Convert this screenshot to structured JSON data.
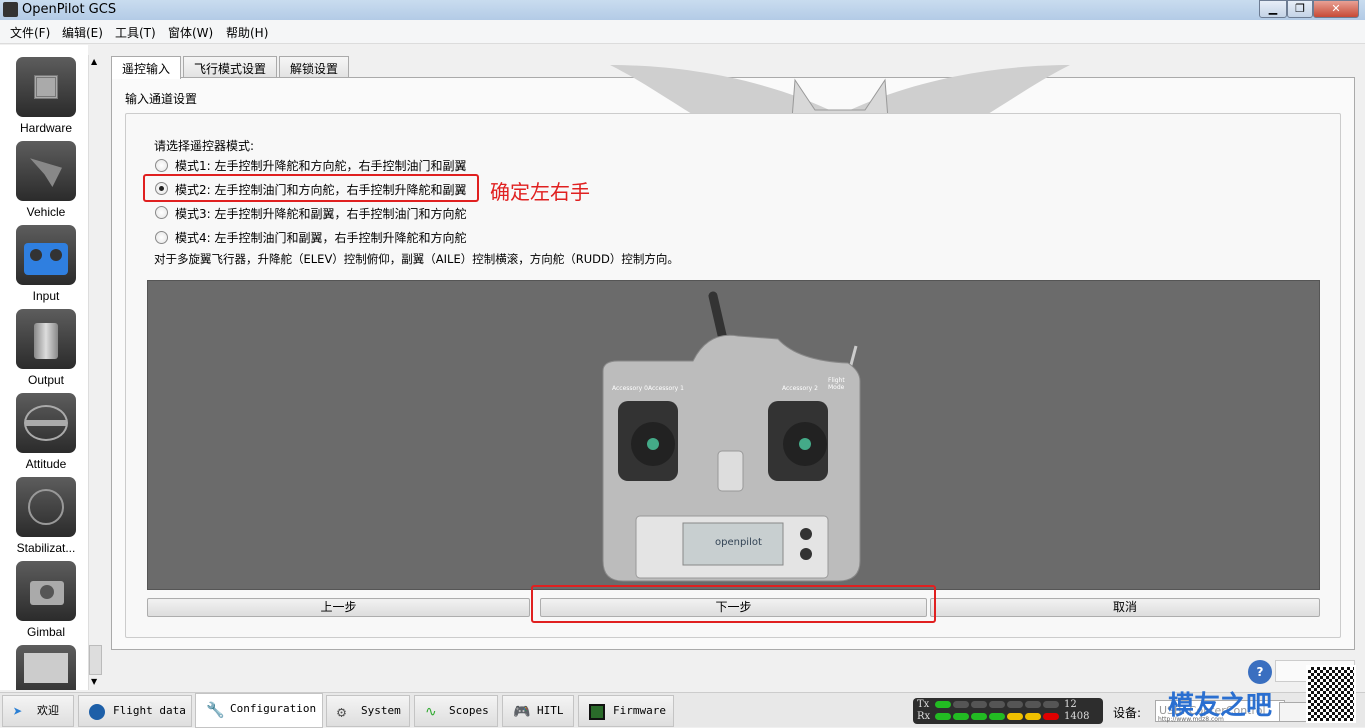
{
  "window": {
    "title": "OpenPilot GCS",
    "controls": [
      "minimize",
      "maximize",
      "close"
    ]
  },
  "menu": [
    "文件(F)",
    "编辑(E)",
    "工具(T)",
    "窗体(W)",
    "帮助(H)"
  ],
  "sidebar": {
    "items": [
      {
        "label": "Hardware",
        "icon": "chip-icon"
      },
      {
        "label": "Vehicle",
        "icon": "aircraft-icon"
      },
      {
        "label": "Input",
        "icon": "transmitter-icon",
        "active": true
      },
      {
        "label": "Output",
        "icon": "motor-icon"
      },
      {
        "label": "Attitude",
        "icon": "level-icon"
      },
      {
        "label": "Stabilizat...",
        "icon": "gyro-icon"
      },
      {
        "label": "Gimbal",
        "icon": "camera-icon"
      },
      {
        "label": "",
        "icon": "gauge-icon"
      }
    ]
  },
  "tabs": [
    {
      "label": "遥控输入",
      "active": true
    },
    {
      "label": "飞行模式设置"
    },
    {
      "label": "解锁设置"
    }
  ],
  "group": {
    "title": "输入通道设置",
    "prompt": "请选择遥控器模式:",
    "modes": [
      {
        "label": "模式1: 左手控制升降舵和方向舵，右手控制油门和副翼",
        "selected": false
      },
      {
        "label": "模式2: 左手控制油门和方向舵，右手控制升降舵和副翼",
        "selected": true
      },
      {
        "label": "模式3: 左手控制升降舵和副翼，右手控制油门和方向舵",
        "selected": false
      },
      {
        "label": "模式4: 左手控制油门和副翼，右手控制升降舵和方向舵",
        "selected": false
      }
    ],
    "note": "对于多旋翼飞行器，升降舵（ELEV）控制俯仰，副翼（AILE）控制横滚，方向舵（RUDD）控制方向。",
    "annotation": "确定左右手",
    "transmitter": {
      "acc0": "Accessory 0",
      "acc1": "Accessory 1",
      "acc2": "Accessory 2",
      "flight_mode": "Flight Mode",
      "brand": "openpilot"
    }
  },
  "buttons": {
    "back": "上一步",
    "next": "下一步",
    "cancel": "取消"
  },
  "bottom_tabs": [
    {
      "label": "欢迎",
      "icon": "welcome-icon"
    },
    {
      "label": "Flight data",
      "icon": "flight-data-icon"
    },
    {
      "label": "Configuration",
      "icon": "wrench-icon",
      "active": true
    },
    {
      "label": "System",
      "icon": "gear-icon"
    },
    {
      "label": "Scopes",
      "icon": "scope-icon"
    },
    {
      "label": "HITL",
      "icon": "gamepad-icon"
    },
    {
      "label": "Firmware",
      "icon": "firmware-chip-icon"
    }
  ],
  "telemetry": {
    "tx_label": "Tx",
    "rx_label": "Rx",
    "tx_value": "12",
    "rx_value": "1408",
    "tx_leds": [
      "green",
      "off",
      "off",
      "off",
      "off",
      "off",
      "off"
    ],
    "rx_leds": [
      "green",
      "green",
      "green",
      "green",
      "yellow",
      "yellow",
      "red"
    ]
  },
  "device": {
    "label": "设备:",
    "value": "USB: CopterControl"
  },
  "watermark": {
    "site": "模友之吧",
    "url": "http://www.mdz8.com"
  },
  "colors": {
    "annotation": "#e02020",
    "led_green": "#22bb22",
    "led_yellow": "#f0c000",
    "led_red": "#e00000"
  }
}
